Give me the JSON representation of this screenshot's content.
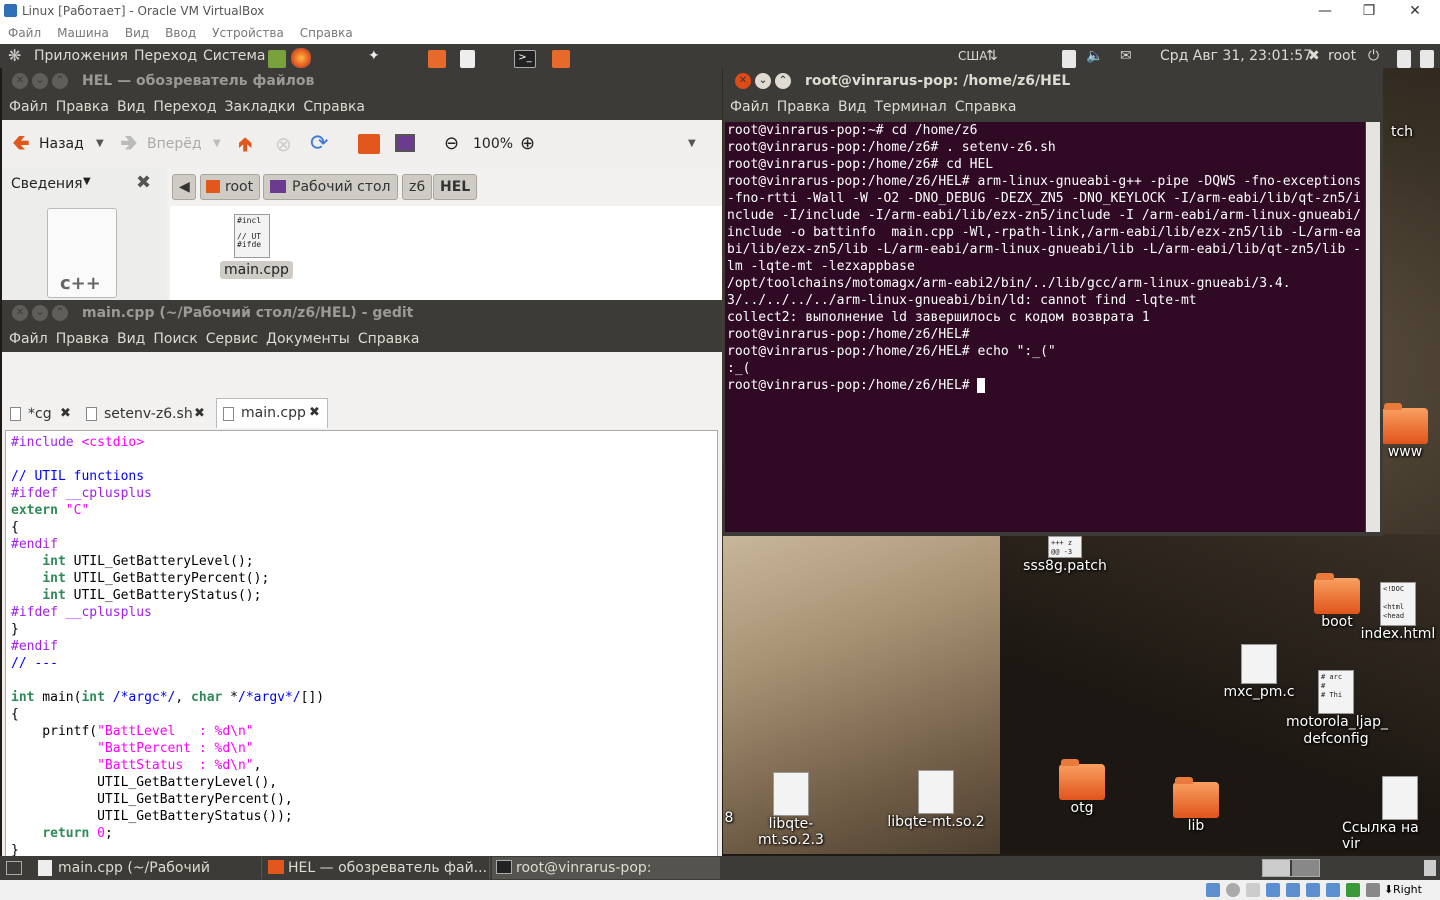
{
  "host": {
    "window_title": "Linux [Работает] - Oracle VM VirtualBox",
    "menu": [
      "Файл",
      "Машина",
      "Вид",
      "Ввод",
      "Устройства",
      "Справка"
    ],
    "status_right": "Right Ctrl"
  },
  "top_panel": {
    "menus": [
      "Приложения",
      "Переход",
      "Система"
    ],
    "keyboard_layout": "США",
    "clock": "Срд Авг 31, 23:01:57",
    "user": "root"
  },
  "nautilus": {
    "title": "HEL — обозреватель файлов",
    "menu": [
      "Файл",
      "Правка",
      "Вид",
      "Переход",
      "Закладки",
      "Справка"
    ],
    "back_label": "Назад",
    "forward_label": "Вперёд",
    "zoom": "100%",
    "sidebar_label": "Сведения",
    "breadcrumbs": [
      "root",
      "Рабочий стол",
      "z6",
      "HEL"
    ],
    "file_name": "main.cpp",
    "file_thumb": "#incl\n\n// UT\n#ifde",
    "sidebar_preview": "c++"
  },
  "gedit": {
    "title": "main.cpp (~/Рабочий стол/z6/HEL) - gedit",
    "menu": [
      "Файл",
      "Правка",
      "Вид",
      "Поиск",
      "Сервис",
      "Документы",
      "Справка"
    ],
    "tabs": [
      "*cg",
      "setenv-z6.sh",
      "main.cpp"
    ]
  },
  "terminal": {
    "title": "root@vinrarus-pop: /home/z6/HEL",
    "menu": [
      "Файл",
      "Правка",
      "Вид",
      "Терминал",
      "Справка"
    ],
    "text": "root@vinrarus-pop:~# cd /home/z6\nroot@vinrarus-pop:/home/z6# . setenv-z6.sh\nroot@vinrarus-pop:/home/z6# cd HEL\nroot@vinrarus-pop:/home/z6/HEL# arm-linux-gnueabi-g++ -pipe -DQWS -fno-exceptions -fno-rtti -Wall -W -O2 -DNO_DEBUG -DEZX_ZN5 -DNO_KEYLOCK -I/arm-eabi/lib/qt-zn5/include -I/include -I/arm-eabi/lib/ezx-zn5/include -I /arm-eabi/arm-linux-gnueabi/include -o battinfo  main.cpp -Wl,-rpath-link,/arm-eabi/lib/ezx-zn5/lib -L/arm-eabi/lib/ezx-zn5/lib -L/arm-eabi/arm-linux-gnueabi/lib -L/arm-eabi/lib/qt-zn5/lib -lm -lqte-mt -lezxappbase\n/opt/toolchains/motomagx/arm-eabi2/bin/../lib/gcc/arm-linux-gnueabi/3.4.3/../../../../arm-linux-gnueabi/bin/ld: cannot find -lqte-mt\ncollect2: выполнение ld завершилось с кодом возврата 1\nroot@vinrarus-pop:/home/z6/HEL#\nroot@vinrarus-pop:/home/z6/HEL# echo \":_(\"\n:_(\nroot@vinrarus-pop:/home/z6/HEL# "
  },
  "desktop_icons": {
    "patch_partial": "tch",
    "www": "www",
    "sss8g": "sss8g.patch",
    "sss8g_thumb": "+++ z\n@@ -3",
    "boot": "boot",
    "index_html": "index.html",
    "index_thumb": "<!DOC\n\n<html\n<head",
    "mxc": "mxc_pm.c",
    "motorola": "motorola_ljap_\ndefconfig",
    "motorola_thumb": "# arc\n#\n# Thi",
    "lib23": "libqte-mt.so.2.3",
    "lib2": "libqte-mt.so.2",
    "otg": "otg",
    "lib": "lib",
    "link": "Ссылка на vir",
    "edge_digit": "8"
  },
  "taskbar": [
    "main.cpp (~/Рабочий стол...",
    "HEL — обозреватель фай...",
    "root@vinrarus-pop: /home/z..."
  ],
  "colors": {
    "panel": "#3c3b37",
    "terminal_bg": "#300a24",
    "folder": "#e1541b",
    "close_btn": "#df4a16"
  }
}
